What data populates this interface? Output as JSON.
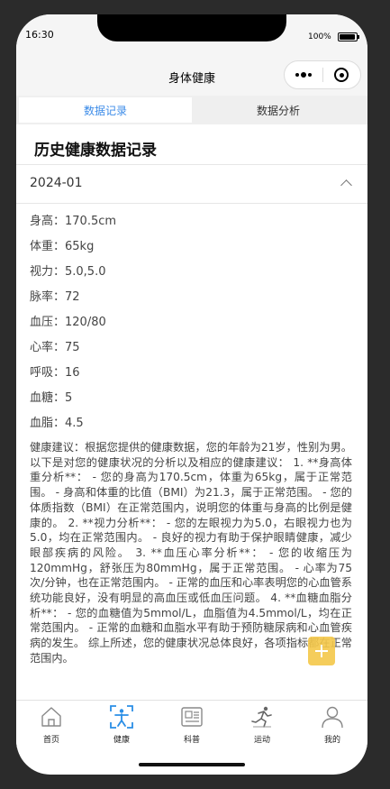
{
  "status_bar": {
    "time": "16:30",
    "battery": "100%"
  },
  "nav": {
    "title": "身体健康"
  },
  "tabs": [
    {
      "label": "数据记录",
      "active": true
    },
    {
      "label": "数据分析",
      "active": false
    }
  ],
  "section_title": "历史健康数据记录",
  "record": {
    "month": "2024-01",
    "metrics": [
      "身高：170.5cm",
      "体重：65kg",
      "视力：5.0,5.0",
      "脉率：72",
      "血压：120/80",
      "心率：75",
      "呼吸：16",
      "血糖：5",
      "血脂：4.5"
    ],
    "advice": "健康建议：根据您提供的健康数据，您的年龄为21岁，性别为男。以下是对您的健康状况的分析以及相应的健康建议： 1. **身高体重分析**： - 您的身高为170.5cm，体重为65kg，属于正常范围。 - 身高和体重的比值（BMI）为21.3，属于正常范围。 - 您的体质指数（BMI）在正常范围内，说明您的体重与身高的比例是健康的。 2. **视力分析**： - 您的左眼视力为5.0，右眼视力也为5.0，均在正常范围内。 - 良好的视力有助于保护眼睛健康，减少眼部疾病的风险。 3. **血压心率分析**： - 您的收缩压为120mmHg，舒张压为80mmHg，属于正常范围。 - 心率为75次/分钟，也在正常范围内。 - 正常的血压和心率表明您的心血管系统功能良好，没有明显的高血压或低血压问题。 4. **血糖血脂分析**： - 您的血糖值为5mmol/L，血脂值为4.5mmol/L，均在正常范围内。 - 正常的血糖和血脂水平有助于预防糖尿病和心血管疾病的发生。 综上所述，您的健康状况总体良好，各项指标都在正常范围内。"
  },
  "tabbar": [
    {
      "label": "首页",
      "icon": "home-icon",
      "active": false
    },
    {
      "label": "健康",
      "icon": "health-icon",
      "active": true
    },
    {
      "label": "科普",
      "icon": "science-icon",
      "active": false
    },
    {
      "label": "运动",
      "icon": "sport-icon",
      "active": false
    },
    {
      "label": "我的",
      "icon": "profile-icon",
      "active": false
    }
  ],
  "colors": {
    "accent": "#3b8be8",
    "fab": "#f5c84a"
  }
}
